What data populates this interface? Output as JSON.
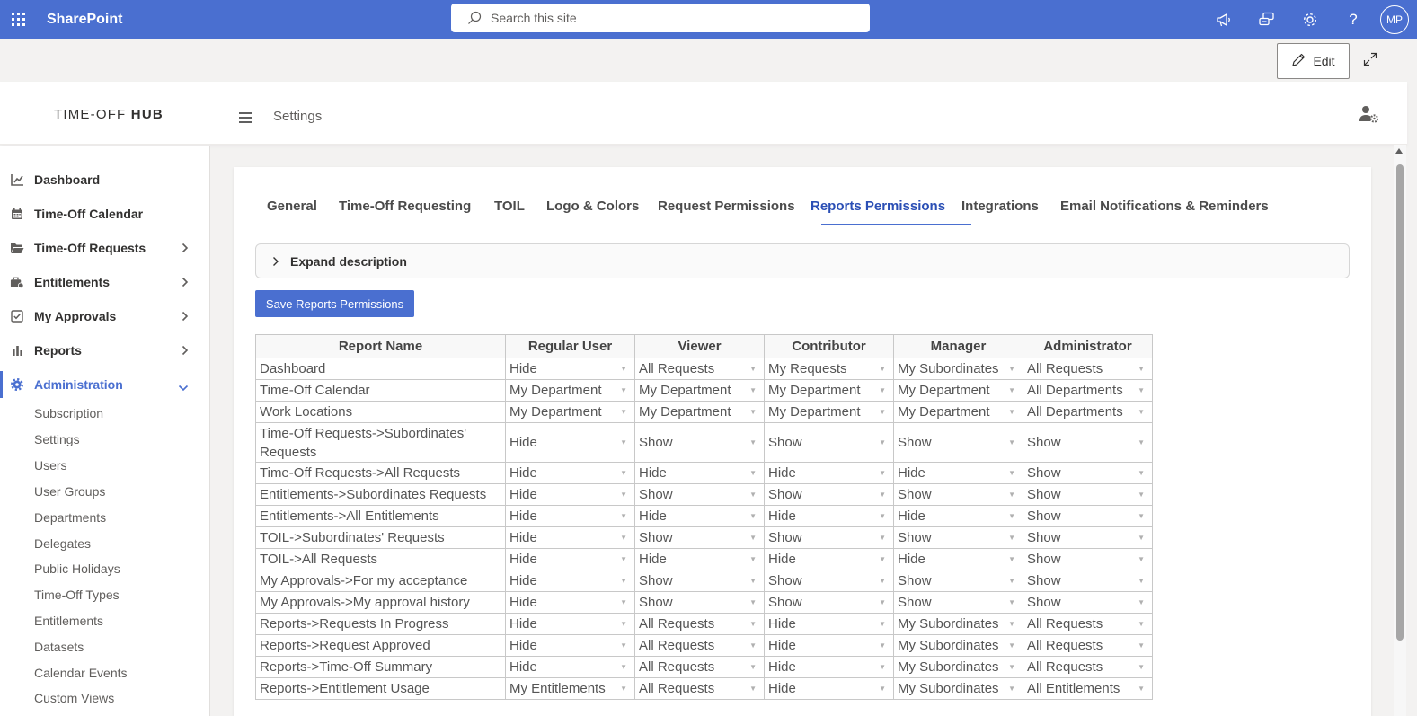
{
  "suitebar": {
    "brand": "SharePoint",
    "search_placeholder": "Search this site",
    "avatar_initials": "MP",
    "help_glyph": "?"
  },
  "commandbar": {
    "edit_label": "Edit"
  },
  "header": {
    "logo_light": "TIME-OFF ",
    "logo_bold": "HUB",
    "breadcrumb": "Settings"
  },
  "sidebar": {
    "items": [
      {
        "label": "Dashboard",
        "icon": "chart-line-icon"
      },
      {
        "label": "Time-Off Calendar",
        "icon": "calendar-icon"
      },
      {
        "label": "Time-Off Requests",
        "icon": "folder-open-icon"
      },
      {
        "label": "Entitlements",
        "icon": "briefcase-icon"
      },
      {
        "label": "My Approvals",
        "icon": "check-square-icon"
      },
      {
        "label": "Reports",
        "icon": "bar-chart-icon"
      },
      {
        "label": "Administration",
        "icon": "gear-icon"
      }
    ],
    "subitems": [
      "Subscription",
      "Settings",
      "Users",
      "User Groups",
      "Departments",
      "Delegates",
      "Public Holidays",
      "Time-Off Types",
      "Entitlements",
      "Datasets",
      "Calendar Events",
      "Custom Views"
    ]
  },
  "tabs": [
    "General",
    "Time-Off Requesting",
    "TOIL",
    "Logo & Colors",
    "Request Permissions",
    "Reports Permissions",
    "Integrations",
    "Email Notifications & Reminders"
  ],
  "active_tab": "Reports Permissions",
  "description_label": "Expand description",
  "save_label": "Save Reports Permissions",
  "table": {
    "headers": [
      "Report Name",
      "Regular User",
      "Viewer",
      "Contributor",
      "Manager",
      "Administrator"
    ],
    "rows": [
      {
        "name": "Dashboard",
        "values": [
          "Hide",
          "All Requests",
          "My Requests",
          "My Subordinates",
          "All Requests"
        ]
      },
      {
        "name": "Time-Off Calendar",
        "values": [
          "My Department",
          "My Department",
          "My Department",
          "My Department",
          "All Departments"
        ]
      },
      {
        "name": "Work Locations",
        "values": [
          "My Department",
          "My Department",
          "My Department",
          "My Department",
          "All Departments"
        ]
      },
      {
        "name": "Time-Off Requests->Subordinates' Requests",
        "values": [
          "Hide",
          "Show",
          "Show",
          "Show",
          "Show"
        ]
      },
      {
        "name": "Time-Off Requests->All Requests",
        "values": [
          "Hide",
          "Hide",
          "Hide",
          "Hide",
          "Show"
        ]
      },
      {
        "name": "Entitlements->Subordinates Requests",
        "values": [
          "Hide",
          "Show",
          "Show",
          "Show",
          "Show"
        ]
      },
      {
        "name": "Entitlements->All Entitlements",
        "values": [
          "Hide",
          "Hide",
          "Hide",
          "Hide",
          "Show"
        ]
      },
      {
        "name": "TOIL->Subordinates' Requests",
        "values": [
          "Hide",
          "Show",
          "Show",
          "Show",
          "Show"
        ]
      },
      {
        "name": "TOIL->All Requests",
        "values": [
          "Hide",
          "Hide",
          "Hide",
          "Hide",
          "Show"
        ]
      },
      {
        "name": "My Approvals->For my acceptance",
        "values": [
          "Hide",
          "Show",
          "Show",
          "Show",
          "Show"
        ]
      },
      {
        "name": "My Approvals->My approval history",
        "values": [
          "Hide",
          "Show",
          "Show",
          "Show",
          "Show"
        ]
      },
      {
        "name": "Reports->Requests In Progress",
        "values": [
          "Hide",
          "All Requests",
          "Hide",
          "My Subordinates",
          "All Requests"
        ]
      },
      {
        "name": "Reports->Request Approved",
        "values": [
          "Hide",
          "All Requests",
          "Hide",
          "My Subordinates",
          "All Requests"
        ]
      },
      {
        "name": "Reports->Time-Off Summary",
        "values": [
          "Hide",
          "All Requests",
          "Hide",
          "My Subordinates",
          "All Requests"
        ]
      },
      {
        "name": "Reports->Entitlement Usage",
        "values": [
          "My Entitlements",
          "All Requests",
          "Hide",
          "My Subordinates",
          "All Entitlements"
        ]
      }
    ]
  },
  "colors": {
    "accent": "#4a6fd0",
    "active_tab_text": "#2b4fb5"
  }
}
